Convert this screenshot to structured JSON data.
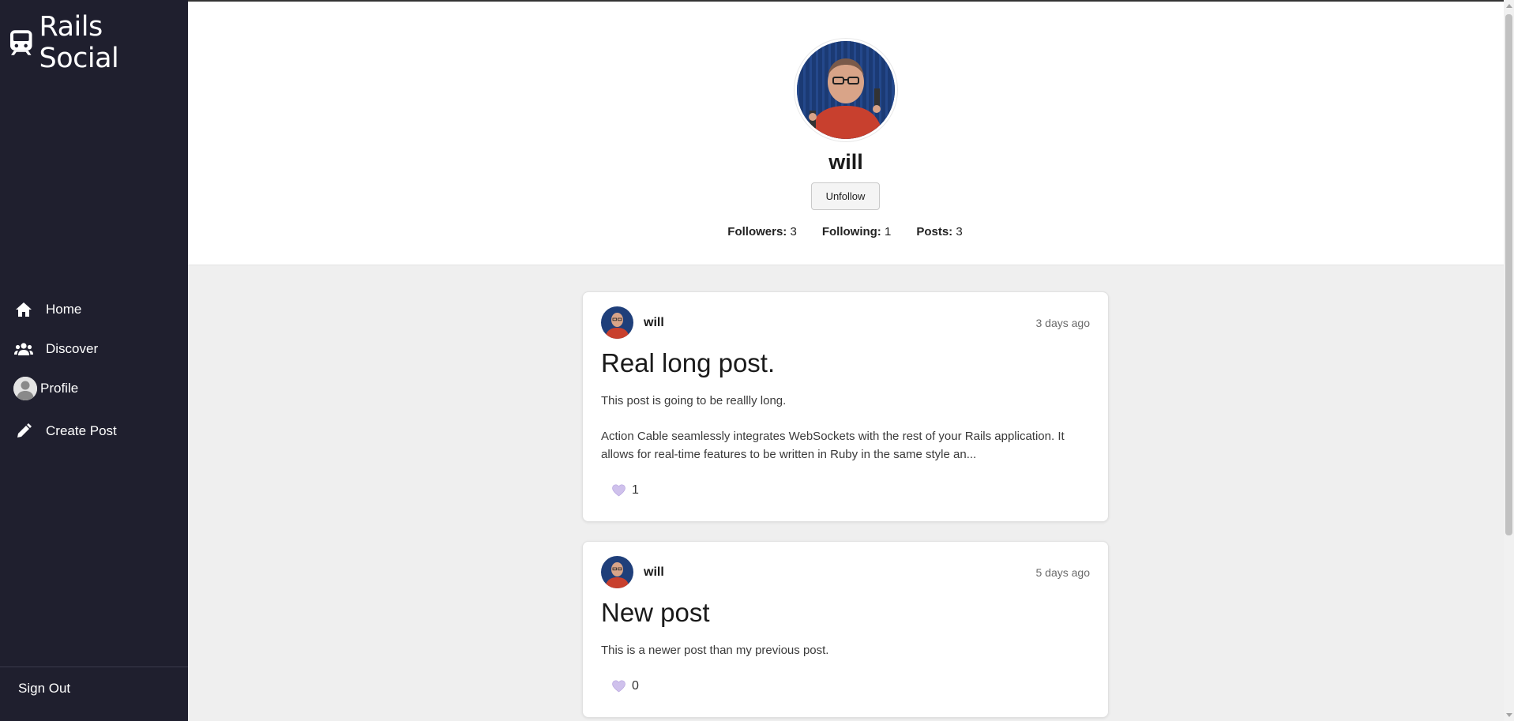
{
  "brand": {
    "name": "Rails Social",
    "icon": "train-icon"
  },
  "nav": {
    "home": "Home",
    "discover": "Discover",
    "profile": "Profile",
    "create_post": "Create Post",
    "sign_out": "Sign Out"
  },
  "profile": {
    "username": "will",
    "action_button": "Unfollow",
    "stats": {
      "followers_label": "Followers:",
      "followers": "3",
      "following_label": "Following:",
      "following": "1",
      "posts_label": "Posts:",
      "posts": "3"
    }
  },
  "posts": [
    {
      "author": "will",
      "time": "3 days ago",
      "title": "Real long post.",
      "paragraphs": [
        "This post is going to be reallly long.",
        "Action Cable seamlessly integrates WebSockets with the rest of your Rails application. It allows for real-time features to be written in Ruby in the same style an..."
      ],
      "likes": "1"
    },
    {
      "author": "will",
      "time": "5 days ago",
      "title": "New post",
      "paragraphs": [
        "This is a newer post than my previous post."
      ],
      "likes": "0"
    }
  ],
  "colors": {
    "sidebar_bg": "#1f1f2e",
    "page_bg": "#efefef",
    "heart": "#c9b8e8"
  }
}
